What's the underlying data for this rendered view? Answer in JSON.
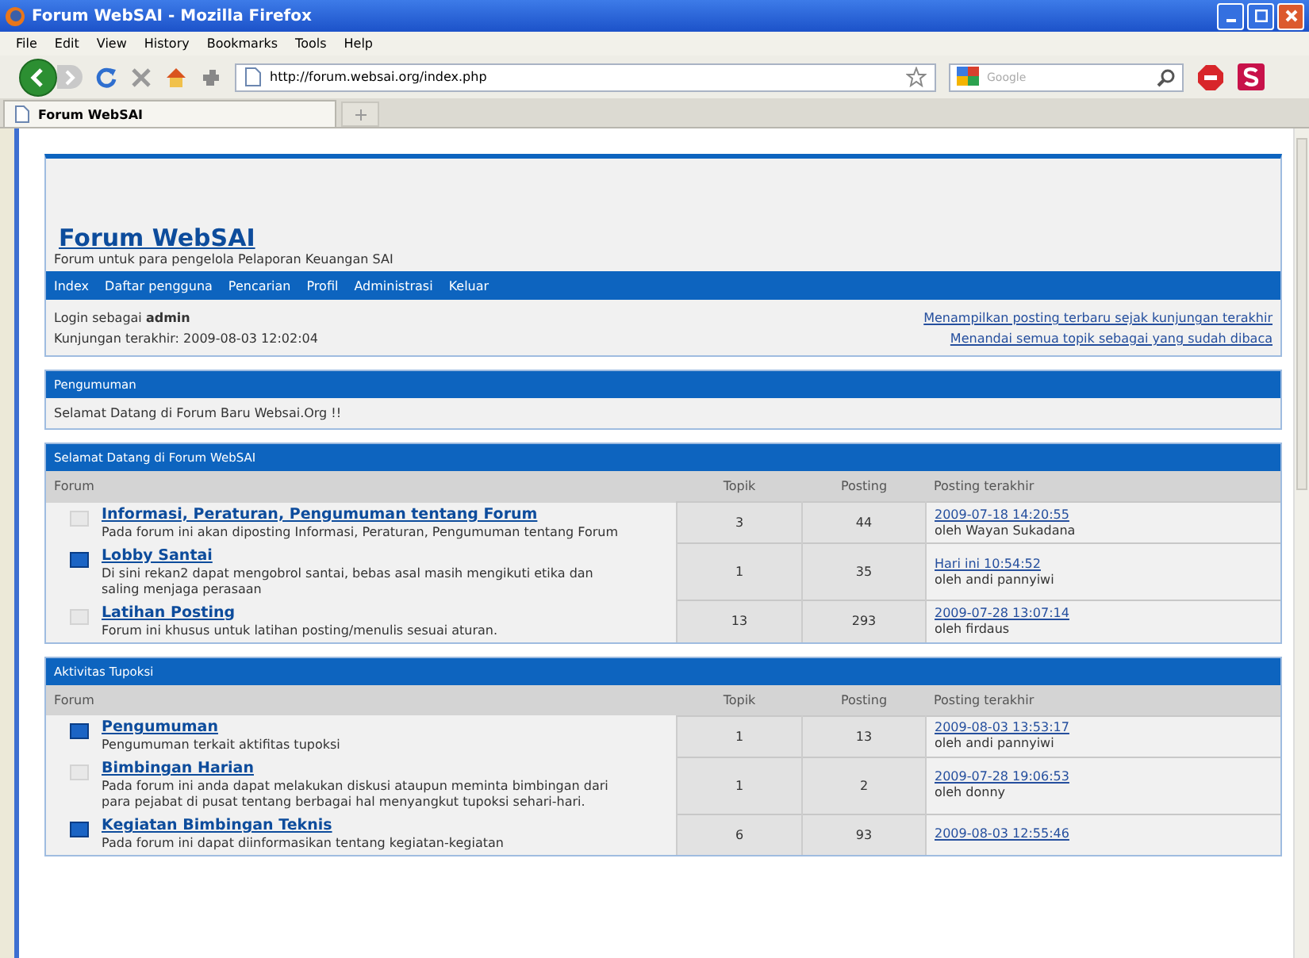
{
  "window": {
    "title": "Forum WebSAI - Mozilla Firefox"
  },
  "menu": [
    "File",
    "Edit",
    "View",
    "History",
    "Bookmarks",
    "Tools",
    "Help"
  ],
  "address": {
    "value": "http://forum.websai.org/index.php"
  },
  "search": {
    "placeholder": "Google"
  },
  "tabs": [
    {
      "label": "Forum WebSAI",
      "selected": true
    }
  ],
  "header": {
    "title": "Forum WebSAI",
    "subtitle": "Forum untuk para pengelola Pelaporan Keuangan SAI"
  },
  "nav": [
    "Index",
    "Daftar pengguna",
    "Pencarian",
    "Profil",
    "Administrasi",
    "Keluar"
  ],
  "login": {
    "prefix": "Login sebagai",
    "user": "admin",
    "last_visit": "Kunjungan terakhir: 2009-08-03 12:02:04",
    "links": [
      "Menampilkan posting terbaru sejak kunjungan terakhir",
      "Menandai semua topik sebagai yang sudah dibaca"
    ]
  },
  "announcement": {
    "title": "Pengumuman",
    "text": "Selamat Datang di Forum Baru Websai.Org !!"
  },
  "sections": [
    {
      "title": "Selamat Datang di Forum WebSAI",
      "columns": [
        "Forum",
        "Topik",
        "Posting",
        "Posting terakhir"
      ],
      "forums": [
        {
          "name": "Informasi, Peraturan, Pengumuman tentang Forum",
          "description": "Pada forum ini akan diposting Informasi, Peraturan, Pengumuman tentang Forum",
          "unread": false,
          "topics": "3",
          "posts": "44",
          "last_date": "2009-07-18 14:20:55",
          "last_by": "oleh Wayan Sukadana"
        },
        {
          "name": "Lobby Santai",
          "description": "Di sini rekan2 dapat mengobrol santai, bebas asal masih mengikuti etika dan saling menjaga perasaan",
          "unread": true,
          "topics": "1",
          "posts": "35",
          "last_date": "Hari ini 10:54:52",
          "last_by": "oleh andi pannyiwi"
        },
        {
          "name": "Latihan Posting",
          "description": "Forum ini khusus untuk latihan posting/menulis sesuai aturan.",
          "unread": false,
          "topics": "13",
          "posts": "293",
          "last_date": "2009-07-28 13:07:14",
          "last_by": "oleh firdaus"
        }
      ]
    },
    {
      "title": "Aktivitas Tupoksi",
      "columns": [
        "Forum",
        "Topik",
        "Posting",
        "Posting terakhir"
      ],
      "forums": [
        {
          "name": "Pengumuman",
          "description": "Pengumuman terkait aktifitas tupoksi",
          "unread": true,
          "topics": "1",
          "posts": "13",
          "last_date": "2009-08-03 13:53:17",
          "last_by": "oleh andi pannyiwi"
        },
        {
          "name": "Bimbingan Harian",
          "description": "Pada forum ini anda dapat melakukan diskusi ataupun meminta bimbingan dari para pejabat di pusat tentang berbagai hal menyangkut tupoksi sehari-hari.",
          "unread": false,
          "topics": "1",
          "posts": "2",
          "last_date": "2009-07-28 19:06:53",
          "last_by": "oleh donny"
        },
        {
          "name": "Kegiatan Bimbingan Teknis",
          "description": "Pada forum ini dapat diinformasikan tentang kegiatan-kegiatan",
          "unread": true,
          "topics": "6",
          "posts": "93",
          "last_date": "2009-08-03 12:55:46"
        }
      ]
    }
  ]
}
